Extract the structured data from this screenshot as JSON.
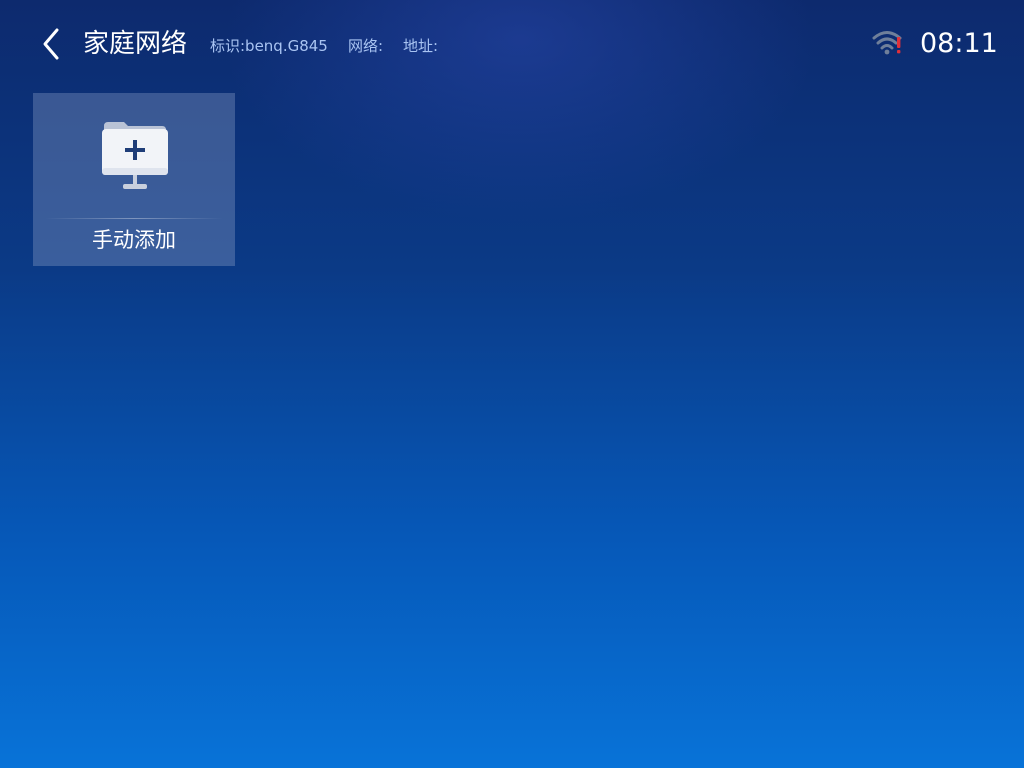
{
  "header": {
    "title": "家庭网络",
    "identifier": "标识:benq.G845",
    "network": "网络:",
    "address": "地址:"
  },
  "status": {
    "time": "08:11",
    "wifi_icon": "wifi-alert-icon",
    "wifi_alert_color": "#e0303a"
  },
  "tiles": [
    {
      "label": "手动添加",
      "icon": "add-network-folder-icon"
    }
  ],
  "colors": {
    "background_top": "#0d2a6e",
    "background_bottom": "#0873d8",
    "info_text": "#a9c4f2"
  }
}
